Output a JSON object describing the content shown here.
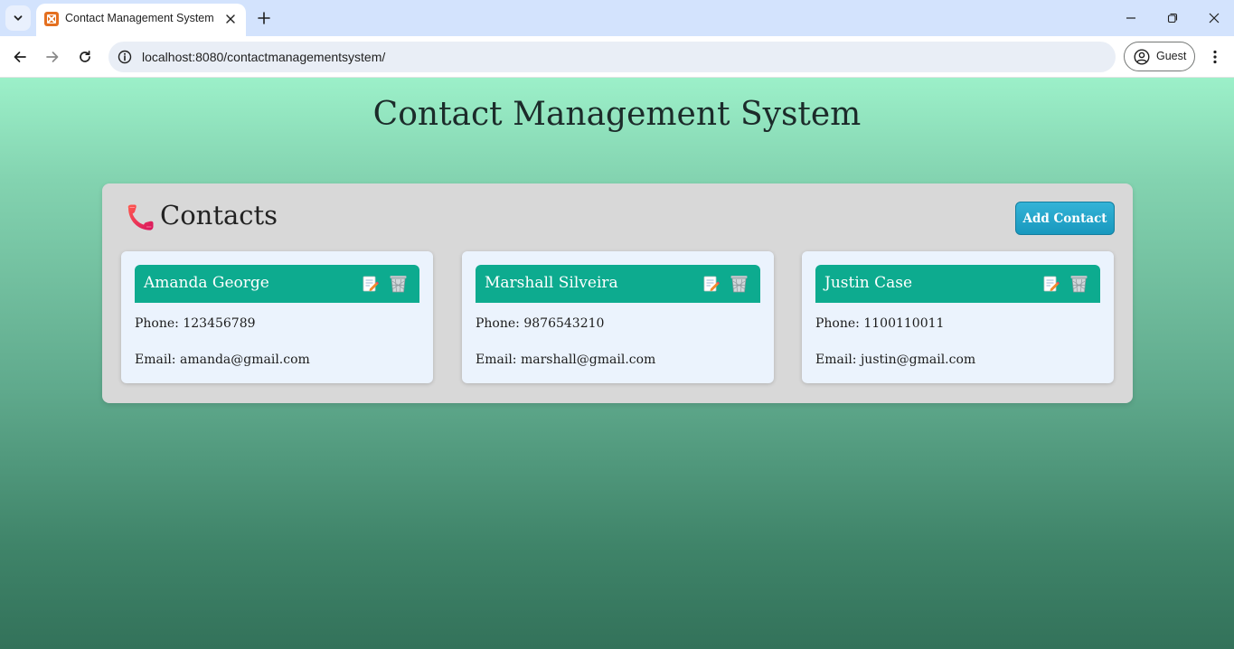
{
  "browser": {
    "tab_title": "Contact Management System",
    "url": "localhost:8080/contactmanagementsystem/",
    "profile_label": "Guest"
  },
  "app": {
    "title": "Contact Management System"
  },
  "panel": {
    "title": "Contacts",
    "add_button_label": "Add Contact"
  },
  "contacts": [
    {
      "name": "Amanda George",
      "phone": "123456789",
      "email": "amanda@gmail.com"
    },
    {
      "name": "Marshall Silveira",
      "phone": "9876543210",
      "email": "marshall@gmail.com"
    },
    {
      "name": "Justin Case",
      "phone": "1100110011",
      "email": "justin@gmail.com"
    }
  ],
  "labels": {
    "phone": "Phone:",
    "email": "Email:"
  },
  "colors": {
    "card_header": "#0dab8f",
    "add_button": "#1fa3c9",
    "panel": "#d8d8d8",
    "card_body": "#ebf3fd"
  },
  "icons": {
    "panel_header": "telephone-receiver-icon",
    "edit": "memo-pencil-icon",
    "delete": "wastebasket-icon"
  }
}
